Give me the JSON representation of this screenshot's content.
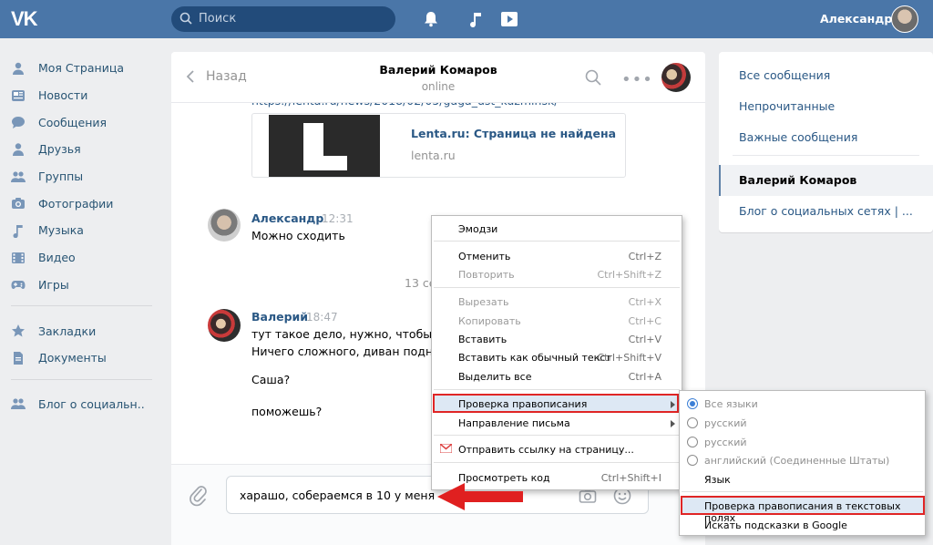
{
  "header": {
    "logo": "VK",
    "search_placeholder": "Поиск",
    "user_name": "Александр",
    "accent": "#4a76a8"
  },
  "leftnav": {
    "items": [
      {
        "label": "Моя Страница",
        "icon": "home-icon"
      },
      {
        "label": "Новости",
        "icon": "news-icon"
      },
      {
        "label": "Сообщения",
        "icon": "messages-icon"
      },
      {
        "label": "Друзья",
        "icon": "friends-icon"
      },
      {
        "label": "Группы",
        "icon": "groups-icon"
      },
      {
        "label": "Фотографии",
        "icon": "camera-icon"
      },
      {
        "label": "Музыка",
        "icon": "music-icon"
      },
      {
        "label": "Видео",
        "icon": "video-icon"
      },
      {
        "label": "Игры",
        "icon": "gamepad-icon"
      }
    ],
    "secondary": [
      {
        "label": "Закладки",
        "icon": "star-icon"
      },
      {
        "label": "Документы",
        "icon": "document-icon"
      }
    ],
    "groups": [
      {
        "label": "Блог о социальн..",
        "icon": "group-icon"
      }
    ]
  },
  "chat": {
    "back_label": "Назад",
    "peer_name": "Валерий Комаров",
    "peer_status": "online",
    "link_text": "https://lenta.ru/news/2018/02/05/gaga_ust_kuzminsk/",
    "link_card": {
      "title": "Lenta.ru: Страница не найдена",
      "domain": "lenta.ru"
    },
    "messages": [
      {
        "author": "Александр",
        "time": "12:31",
        "lines": [
          "Можно сходить"
        ]
      },
      {
        "author": "Валерий",
        "time": "18:47",
        "lines": [
          "тут такое дело, нужно, чтобы т",
          "Ничего сложного, диван подня",
          "Саша?",
          "поможешь?"
        ]
      }
    ],
    "date_separator": "13 се",
    "compose_text": "харашо, собераемся в 10 у меня"
  },
  "rightpanel": {
    "items": [
      "Все сообщения",
      "Непрочитанные",
      "Важные сообщения",
      "Валерий Комаров",
      "Блог о социальных сетях | ..."
    ]
  },
  "context_menu": {
    "emoji": "Эмодзи",
    "undo": {
      "label": "Отменить",
      "shortcut": "Ctrl+Z"
    },
    "redo": {
      "label": "Повторить",
      "shortcut": "Ctrl+Shift+Z"
    },
    "cut": {
      "label": "Вырезать",
      "shortcut": "Ctrl+X"
    },
    "copy": {
      "label": "Копировать",
      "shortcut": "Ctrl+C"
    },
    "paste": {
      "label": "Вставить",
      "shortcut": "Ctrl+V"
    },
    "paste_plain": {
      "label": "Вставить как обычный текст",
      "shortcut": "Ctrl+Shift+V"
    },
    "select_all": {
      "label": "Выделить все",
      "shortcut": "Ctrl+A"
    },
    "spellcheck": "Проверка правописания",
    "writing_direction": "Направление письма",
    "send_link": "Отправить ссылку на страницу...",
    "view_source": {
      "label": "Просмотреть код",
      "shortcut": "Ctrl+Shift+I"
    }
  },
  "submenu": {
    "langs": [
      "Все языки",
      "русский",
      "русский",
      "английский (Соединенные Штаты)"
    ],
    "language": "Язык",
    "spell_fields": "Проверка правописания в текстовых полях",
    "google_hints": "Искать подсказки в Google"
  }
}
